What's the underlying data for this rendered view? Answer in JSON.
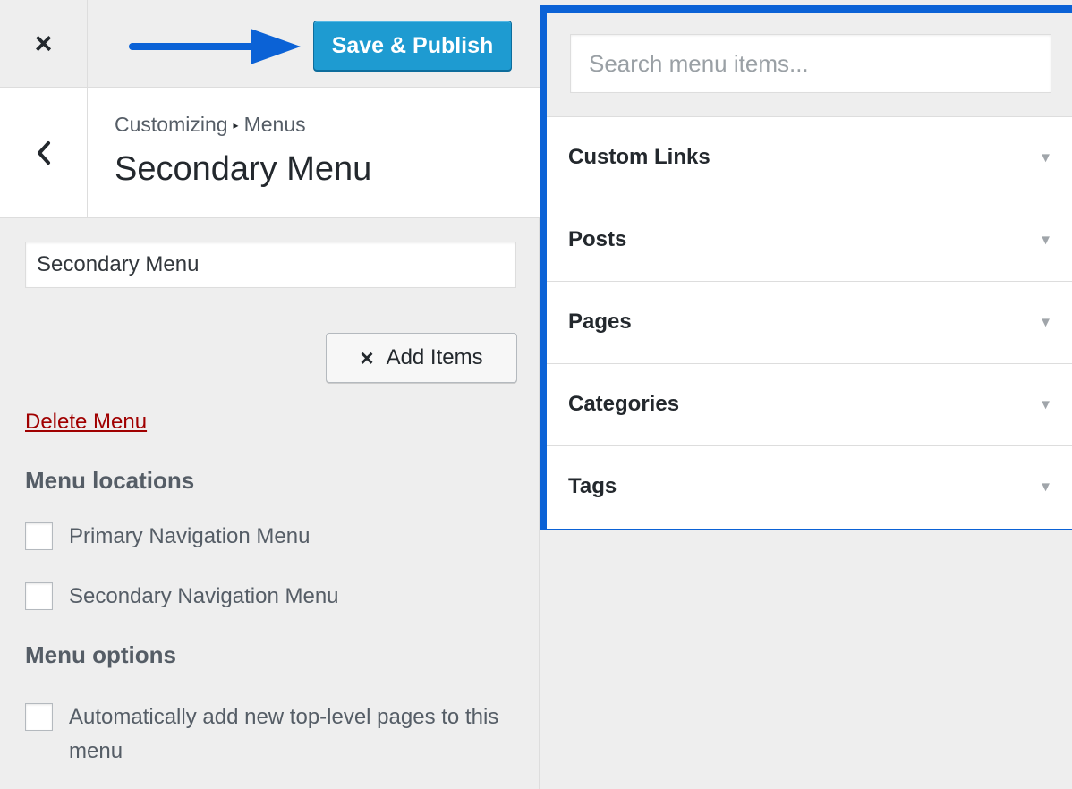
{
  "header": {
    "close_icon": "×",
    "save_label": "Save & Publish",
    "annotation_arrow_color": "#0b62d6",
    "save_color": "#1e9bd1"
  },
  "title_bar": {
    "back_icon": "chevron-left",
    "breadcrumb_root": "Customizing",
    "breadcrumb_sep": "▸",
    "breadcrumb_section": "Menus",
    "title": "Secondary Menu"
  },
  "menu_name": {
    "value": "Secondary Menu"
  },
  "add_items": {
    "icon": "×",
    "label": "Add Items"
  },
  "delete_menu": {
    "label": "Delete Menu",
    "color": "#a00000"
  },
  "menu_locations": {
    "heading": "Menu locations",
    "items": [
      {
        "label": "Primary Navigation Menu",
        "checked": false
      },
      {
        "label": "Secondary Navigation Menu",
        "checked": false
      }
    ]
  },
  "menu_options": {
    "heading": "Menu options",
    "items": [
      {
        "label": "Automatically add new top-level pages to this menu",
        "checked": false
      }
    ]
  },
  "available_items": {
    "highlight_color": "#0b62d6",
    "search_placeholder": "Search menu items...",
    "sections": [
      {
        "label": "Custom Links",
        "caret": "▼"
      },
      {
        "label": "Posts",
        "caret": "▼"
      },
      {
        "label": "Pages",
        "caret": "▼"
      },
      {
        "label": "Categories",
        "caret": "▼"
      },
      {
        "label": "Tags",
        "caret": "▼"
      }
    ]
  }
}
